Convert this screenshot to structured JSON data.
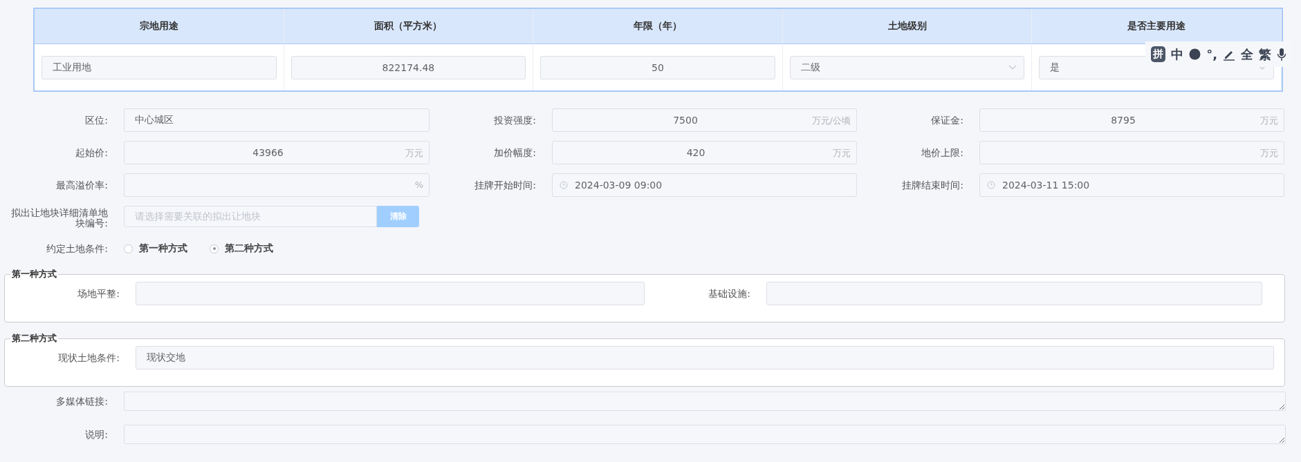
{
  "use_table": {
    "columns": [
      "宗地用途",
      "面积（平方米）",
      "年限（年）",
      "土地级别",
      "是否主要用途"
    ],
    "row": [
      {
        "kind": "text",
        "value": "工业用地"
      },
      {
        "kind": "number",
        "value": "822174.48"
      },
      {
        "kind": "number",
        "value": "50"
      },
      {
        "kind": "select",
        "value": "二级"
      },
      {
        "kind": "select",
        "value": "是"
      }
    ]
  },
  "fields": [
    {
      "kind": "text",
      "label": "区位:",
      "value": "中心城区"
    },
    {
      "kind": "number",
      "label": "投资强度:",
      "value": "7500",
      "unit": "万元/公顷"
    },
    {
      "kind": "number",
      "label": "保证金:",
      "value": "8795",
      "unit": "万元"
    },
    {
      "kind": "number",
      "label": "起始价:",
      "value": "43966",
      "unit": "万元"
    },
    {
      "kind": "number",
      "label": "加价幅度:",
      "value": "420",
      "unit": "万元"
    },
    {
      "kind": "number",
      "label": "地价上限:",
      "unit": "万元"
    },
    {
      "kind": "number",
      "label": "最高溢价率:",
      "unit": "%"
    },
    {
      "kind": "datetime",
      "label": "挂牌开始时间:",
      "value": "2024-03-09 09:00"
    },
    {
      "kind": "datetime",
      "label": "挂牌结束时间:",
      "value": "2024-03-11 15:00"
    }
  ],
  "parcel_picker": {
    "label": "拟出让地块详细清单地块编号:",
    "placeholder": "请选择需要关联的拟出让地块",
    "button": "清除",
    "button_disabled": true
  },
  "land_condition": {
    "label": "约定土地条件:",
    "options": [
      {
        "label": "第一种方式",
        "selected": false
      },
      {
        "label": "第二种方式",
        "selected": true
      }
    ]
  },
  "fieldsets": [
    {
      "legend": "第一种方式",
      "fields": [
        {
          "label": "场地平整:"
        },
        {
          "label": "基础设施:"
        }
      ]
    },
    {
      "legend": "第二种方式",
      "fields": [
        {
          "label": "现状土地条件:",
          "value": "现状交地"
        }
      ]
    }
  ],
  "textareas": [
    {
      "label": "多媒体链接:"
    },
    {
      "label": "说明:"
    }
  ],
  "ime_toolbar": [
    {
      "kind": "badge",
      "text": "拼"
    },
    {
      "kind": "text",
      "text": "中"
    },
    {
      "kind": "dot"
    },
    {
      "kind": "text",
      "text": "°,"
    },
    {
      "kind": "pen"
    },
    {
      "kind": "text",
      "text": "全"
    },
    {
      "kind": "text",
      "text": "繁"
    },
    {
      "kind": "mic"
    }
  ]
}
